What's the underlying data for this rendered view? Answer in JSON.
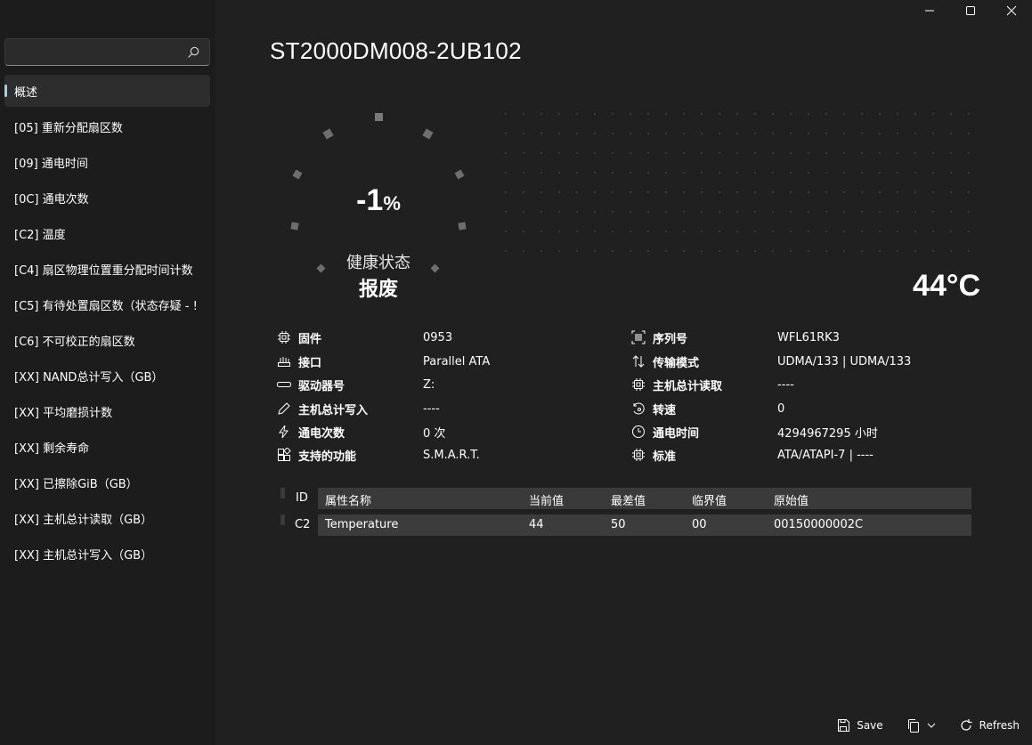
{
  "sidebar": {
    "search": {
      "placeholder": ""
    },
    "items": [
      {
        "label": "概述",
        "active": true
      },
      {
        "label": "[05] 重新分配扇区数"
      },
      {
        "label": "[09] 通电时间"
      },
      {
        "label": "[0C] 通电次数"
      },
      {
        "label": "[C2] 温度"
      },
      {
        "label": "[C4] 扇区物理位置重分配时间计数"
      },
      {
        "label": "[C5] 有待处置扇区数（状态存疑 - !"
      },
      {
        "label": "[C6] 不可校正的扇区数"
      },
      {
        "label": "[XX] NAND总计写入（GB）"
      },
      {
        "label": "[XX] 平均磨损计数"
      },
      {
        "label": "[XX] 剩余寿命"
      },
      {
        "label": "[XX] 已擦除GiB（GB）"
      },
      {
        "label": "[XX] 主机总计读取（GB）"
      },
      {
        "label": "[XX] 主机总计写入（GB）"
      }
    ]
  },
  "main": {
    "title": "ST2000DM008-2UB102",
    "health": {
      "percent": "-1",
      "percent_sign": "%",
      "label": "健康状态",
      "status": "报废"
    },
    "temperature": "44°C",
    "info_left": [
      {
        "icon": "chip-icon",
        "label": "固件",
        "value": "0953"
      },
      {
        "icon": "interface-icon",
        "label": "接口",
        "value": "Parallel ATA"
      },
      {
        "icon": "drive-icon",
        "label": "驱动器号",
        "value": "Z:"
      },
      {
        "icon": "pencil-icon",
        "label": "主机总计写入",
        "value": "----"
      },
      {
        "icon": "power-icon",
        "label": "通电次数",
        "value": "0 次"
      },
      {
        "icon": "features-icon",
        "label": "支持的功能",
        "value": "S.M.A.R.T."
      }
    ],
    "info_right": [
      {
        "icon": "barcode-icon",
        "label": "序列号",
        "value": "WFL61RK3"
      },
      {
        "icon": "transfer-icon",
        "label": "传输模式",
        "value": "UDMA/133 | UDMA/133"
      },
      {
        "icon": "chip-icon",
        "label": "主机总计读取",
        "value": "----"
      },
      {
        "icon": "rotation-icon",
        "label": "转速",
        "value": "0"
      },
      {
        "icon": "clock-icon",
        "label": "通电时间",
        "value": "4294967295 小时"
      },
      {
        "icon": "chip-icon",
        "label": "标准",
        "value": "ATA/ATAPI-7 | ----"
      }
    ],
    "table": {
      "headers": [
        "ID",
        "属性名称",
        "当前值",
        "最差值",
        "临界值",
        "原始值"
      ],
      "rows": [
        [
          "C2",
          "Temperature",
          "44",
          "50",
          "00",
          "00150000002C"
        ]
      ]
    }
  },
  "bottombar": {
    "save_label": "Save",
    "refresh_label": "Refresh"
  },
  "colors": {
    "background": "#202020",
    "sidebar": "#1c1c1c",
    "accent": "#9ecbf0"
  }
}
